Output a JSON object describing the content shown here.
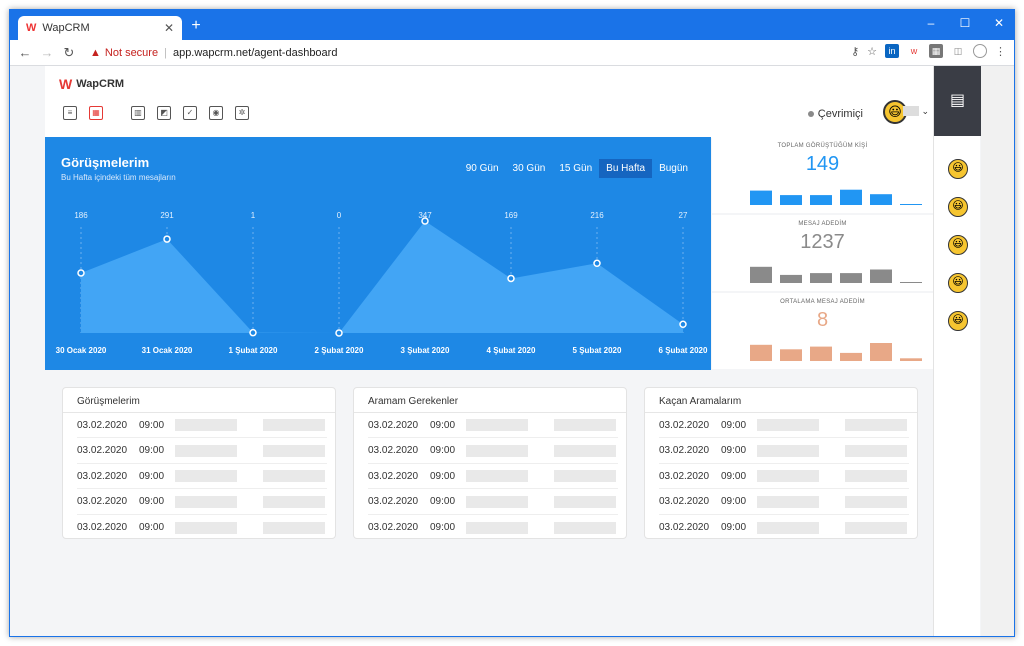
{
  "browser": {
    "tab_title": "WapCRM",
    "tab_icon": "W",
    "new_tab": "+",
    "security": "Not secure",
    "url": "app.wapcrm.net/agent-dashboard",
    "minimize": "–",
    "maximize": "☐",
    "close": "✕",
    "back": "←",
    "forward": "→",
    "reload": "↻"
  },
  "app": {
    "logo_text": "WapCRM",
    "logo_mark": "W",
    "status_label": "Çevrimiçi",
    "avatar_emoji": "😃",
    "caret": "⌄"
  },
  "chart_panel": {
    "title": "Görüşmelerim",
    "subtitle": "Bu Hafta içindeki tüm mesajların",
    "ranges": [
      "90 Gün",
      "30 Gün",
      "15 Gün",
      "Bu Hafta",
      "Bugün"
    ],
    "active_range": 3
  },
  "chart_data": {
    "type": "area",
    "categories": [
      "30 Ocak 2020",
      "31 Ocak 2020",
      "1 Şubat 2020",
      "2 Şubat 2020",
      "3 Şubat 2020",
      "4 Şubat 2020",
      "5 Şubat 2020",
      "6 Şubat 2020"
    ],
    "values": [
      186,
      291,
      1,
      0,
      347,
      169,
      216,
      27
    ],
    "ylim": [
      0,
      347
    ],
    "grid": false
  },
  "stats": [
    {
      "label": "TOPLAM GÖRÜŞTÜĞÜM KİŞİ",
      "value": "149",
      "color": "#2196f3",
      "bars": [
        0.8,
        0.55,
        0.55,
        0.85,
        0.6,
        0.05
      ]
    },
    {
      "label": "MESAJ ADEDİM",
      "value": "1237",
      "color": "#8a8a8a",
      "bars": [
        0.9,
        0.45,
        0.55,
        0.55,
        0.75,
        0.0
      ]
    },
    {
      "label": "ORTALAMA MESAJ ADEDİM",
      "value": "8",
      "color": "#e8a887",
      "bars": [
        0.9,
        0.65,
        0.8,
        0.45,
        1.0,
        0.15
      ]
    }
  ],
  "lists": [
    {
      "title": "Görüşmelerim",
      "rows": [
        {
          "date": "03.02.2020",
          "time": "09:00"
        },
        {
          "date": "03.02.2020",
          "time": "09:00"
        },
        {
          "date": "03.02.2020",
          "time": "09:00"
        },
        {
          "date": "03.02.2020",
          "time": "09:00"
        },
        {
          "date": "03.02.2020",
          "time": "09:00"
        }
      ]
    },
    {
      "title": "Aramam Gerekenler",
      "rows": [
        {
          "date": "03.02.2020",
          "time": "09:00"
        },
        {
          "date": "03.02.2020",
          "time": "09:00"
        },
        {
          "date": "03.02.2020",
          "time": "09:00"
        },
        {
          "date": "03.02.2020",
          "time": "09:00"
        },
        {
          "date": "03.02.2020",
          "time": "09:00"
        }
      ]
    },
    {
      "title": "Kaçan Aramalarım",
      "rows": [
        {
          "date": "03.02.2020",
          "time": "09:00"
        },
        {
          "date": "03.02.2020",
          "time": "09:00"
        },
        {
          "date": "03.02.2020",
          "time": "09:00"
        },
        {
          "date": "03.02.2020",
          "time": "09:00"
        },
        {
          "date": "03.02.2020",
          "time": "09:00"
        }
      ]
    }
  ],
  "sidebar": {
    "chat_icon": "▤",
    "users": [
      "😃",
      "😃",
      "😃",
      "😃",
      "😃"
    ]
  }
}
